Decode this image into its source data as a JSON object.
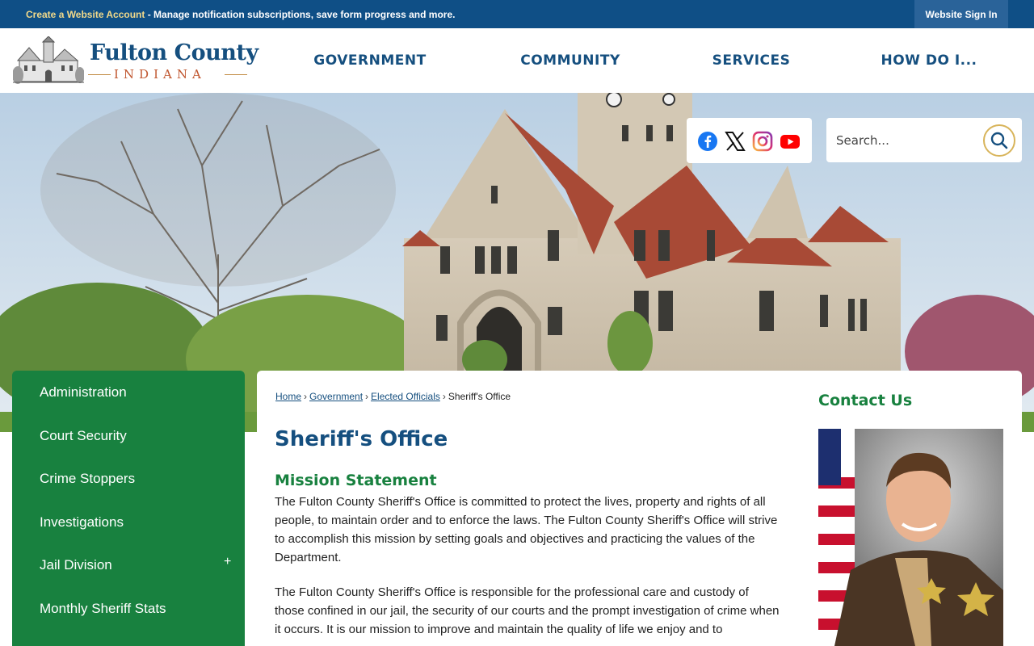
{
  "topbar": {
    "create_account_link": "Create a Website Account",
    "message": " - Manage notification subscriptions, save form progress and more.",
    "sign_in": "Website Sign In"
  },
  "logo": {
    "line1": "Fulton County",
    "line2": "INDIANA"
  },
  "nav": {
    "items": [
      "GOVERNMENT",
      "COMMUNITY",
      "SERVICES",
      "HOW DO I..."
    ]
  },
  "social": {
    "icons": [
      "facebook-icon",
      "x-twitter-icon",
      "instagram-icon",
      "youtube-icon"
    ]
  },
  "search": {
    "placeholder": "Search..."
  },
  "sidebar": {
    "items": [
      {
        "label": "Administration"
      },
      {
        "label": "Court Security"
      },
      {
        "label": "Crime Stoppers"
      },
      {
        "label": "Investigations"
      },
      {
        "label": "Jail Division",
        "expand": "+"
      },
      {
        "label": "Monthly Sheriff Stats"
      }
    ]
  },
  "breadcrumb": {
    "home": "Home",
    "government": "Government",
    "elected": "Elected Officials",
    "current": "Sheriff's Office"
  },
  "main": {
    "title": "Sheriff's Office",
    "mission_heading": "Mission Statement",
    "para1": "The Fulton County Sheriff's Office is committed to protect the lives, property and rights of all people, to maintain order and to enforce the laws. The Fulton County Sheriff's Office will strive to accomplish this mission by setting goals and objectives and practicing the values of the Department.",
    "para2": "The Fulton County Sheriff's Office is responsible for the professional care and custody of those confined in our jail, the security of our courts and the prompt investigation of crime when it occurs. It is our mission to improve and maintain the quality of life we enjoy and to"
  },
  "contact": {
    "heading": "Contact Us"
  },
  "colors": {
    "topbar": "#0f4f86",
    "brand_blue": "#154f7f",
    "brand_green": "#18813f",
    "accent_gold": "#d8b45a"
  }
}
